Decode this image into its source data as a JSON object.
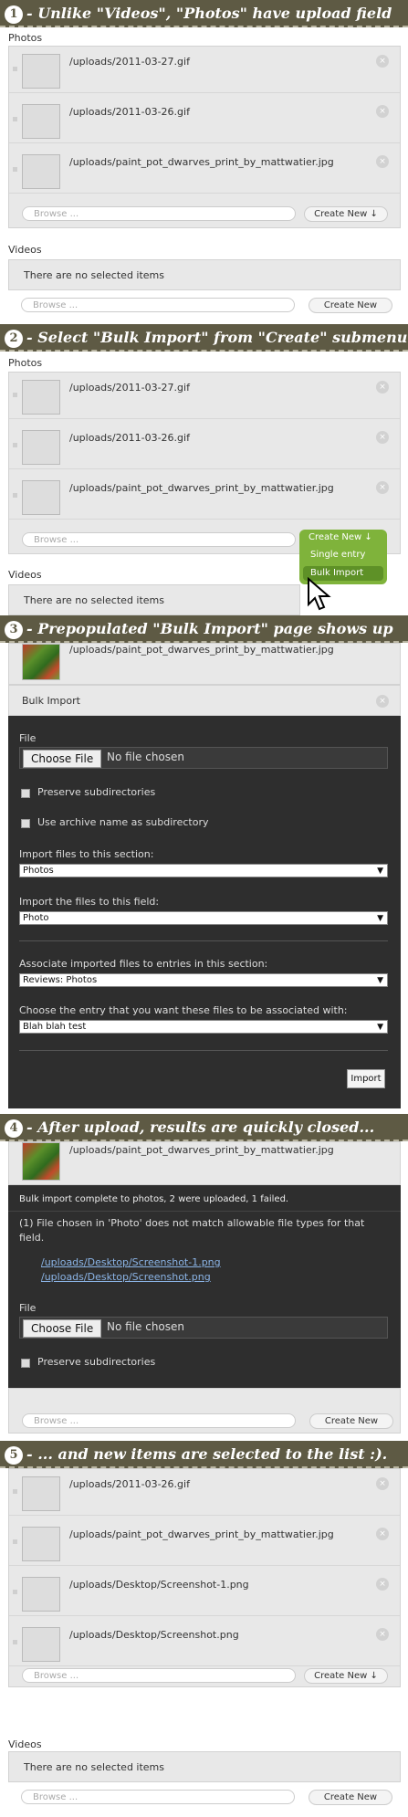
{
  "banners": [
    {
      "num": "1",
      "text": "- Unlike \"Videos\", \"Photos\" have upload field"
    },
    {
      "num": "2",
      "text": "- Select \"Bulk Import\" from \"Create\" submenu"
    },
    {
      "num": "3",
      "text": "- Prepopulated \"Bulk Import\" page shows up"
    },
    {
      "num": "4",
      "text": "- After upload, results are quickly closed..."
    },
    {
      "num": "5",
      "text": "- ... and new items are selected to the list :)."
    }
  ],
  "labels": {
    "photos": "Photos",
    "videos": "Videos",
    "no_items": "There are no selected items",
    "browse": "Browse ...",
    "create_new_arrow": "Create New ↓",
    "create_new": "Create New",
    "remove": "×"
  },
  "files": {
    "f1": "/uploads/2011-03-27.gif",
    "f2": "/uploads/2011-03-26.gif",
    "f3": "/uploads/paint_pot_dwarves_print_by_mattwatier.jpg",
    "f4": "/uploads/Desktop/Screenshot-1.png",
    "f5": "/uploads/Desktop/Screenshot.png"
  },
  "menu": {
    "create": "Create New ↓",
    "single": "Single entry",
    "bulk": "Bulk Import"
  },
  "bulk": {
    "title": "Bulk Import",
    "file_label": "File",
    "choose": "Choose File",
    "no_file": "No file chosen",
    "preserve": "Preserve subdirectories",
    "archive": "Use archive name as subdirectory",
    "import_section_label": "Import files to this section:",
    "import_section_value": "Photos",
    "import_field_label": "Import the files to this field:",
    "import_field_value": "Photo",
    "assoc_label": "Associate imported files to entries in this section:",
    "assoc_value": "Reviews: Photos",
    "entry_label": "Choose the entry that you want these files to be associated with:",
    "entry_value": "Blah blah test",
    "import_btn": "Import"
  },
  "result": {
    "complete": "Bulk import complete to photos, 2 were uploaded, 1 failed.",
    "error": "(1) File chosen in 'Photo' does not match allowable file types for that field.",
    "link1": "/uploads/Desktop/Screenshot-1.png",
    "link2": "/uploads/Desktop/Screenshot.png"
  }
}
